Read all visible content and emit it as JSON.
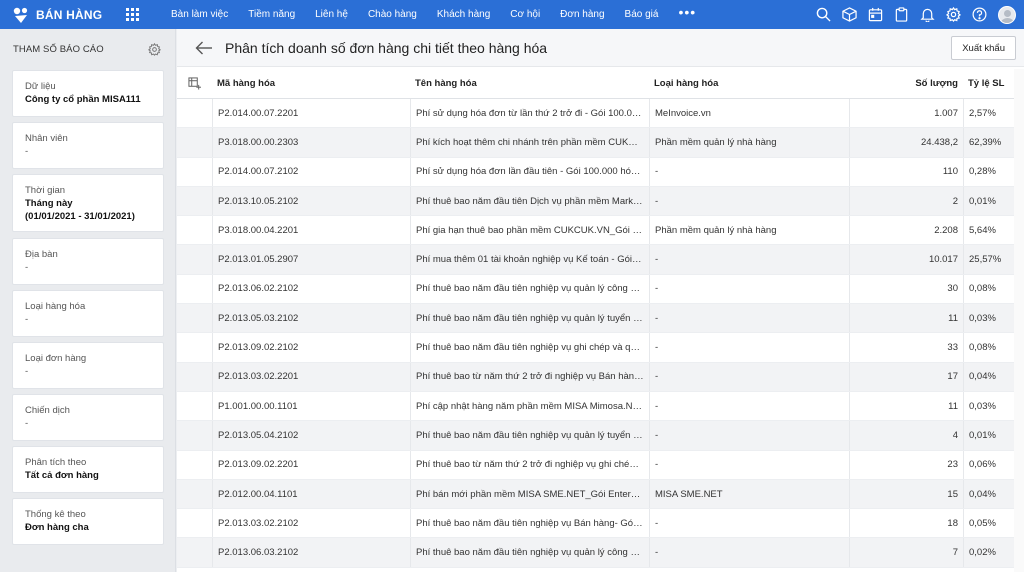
{
  "app": {
    "brand": "BÁN HÀNG",
    "nav": [
      "Bàn làm việc",
      "Tiềm năng",
      "Liên hệ",
      "Chào hàng",
      "Khách hàng",
      "Cơ hội",
      "Đơn hàng",
      "Báo giá"
    ],
    "nav_more": "•••",
    "icons": [
      "search-icon",
      "cube-icon",
      "calendar-icon",
      "clipboard-icon",
      "bell-icon",
      "gear-icon",
      "help-icon",
      "avatar"
    ],
    "accent_color": "#2b6fd6"
  },
  "sidebar": {
    "title": "THAM SỐ BÁO CÁO",
    "params": [
      {
        "label": "Dữ liệu",
        "value": "Công ty cổ phần MISA111",
        "value2": ""
      },
      {
        "label": "Nhân viên",
        "value": "-",
        "value2": ""
      },
      {
        "label": "Thời gian",
        "value": "Tháng này",
        "value2": "(01/01/2021 - 31/01/2021)"
      },
      {
        "label": "Địa bàn",
        "value": "-",
        "value2": ""
      },
      {
        "label": "Loại hàng hóa",
        "value": "-",
        "value2": ""
      },
      {
        "label": "Loại đơn hàng",
        "value": "-",
        "value2": ""
      },
      {
        "label": "Chiến dịch",
        "value": "-",
        "value2": ""
      },
      {
        "label": "Phân tích theo",
        "value": "Tất cả đơn hàng",
        "value2": ""
      },
      {
        "label": "Thống kê theo",
        "value": "Đơn hàng cha",
        "value2": ""
      }
    ]
  },
  "main": {
    "title": "Phân tích doanh số đơn hàng chi tiết theo hàng hóa",
    "export_label": "Xuất khẩu",
    "columns": [
      "Mã hàng hóa",
      "Tên hàng hóa",
      "Loại hàng hóa",
      "Số lượng",
      "Tỷ lệ SL"
    ],
    "rows": [
      {
        "code": "P2.014.00.07.2201",
        "name": "Phí sử dụng hóa đơn từ lần thứ 2 trở đi - Gói 100.000...",
        "type": "MeInvoice.vn",
        "qty": "1.007",
        "ratio": "2,57%"
      },
      {
        "code": "P3.018.00.00.2303",
        "name": "Phí kích hoạt thêm chi nhánh trên phần mềm CUKCU...",
        "type": "Phần mềm quản lý nhà hàng",
        "qty": "24.438,2",
        "ratio": "62,39%"
      },
      {
        "code": "P2.014.00.07.2102",
        "name": "Phí sử dụng hóa đơn lần đầu tiên - Gói 100.000 hóa ...",
        "type": "-",
        "qty": "110",
        "ratio": "0,28%"
      },
      {
        "code": "P2.013.10.05.2102",
        "name": "Phí thuê bao năm đầu tiên Dịch vụ phần mềm Marke...",
        "type": "-",
        "qty": "2",
        "ratio": "0,01%"
      },
      {
        "code": "P3.018.00.04.2201",
        "name": "Phí gia hạn thuê bao phần mềm CUKCUK.VN_Gói Ent...",
        "type": "Phần mềm quản lý nhà hàng",
        "qty": "2.208",
        "ratio": "5,64%"
      },
      {
        "code": "P2.013.01.05.2907",
        "name": "Phí mua thêm 01 tài khoản nghiệp vụ Kế toán - Gói U...",
        "type": "-",
        "qty": "10.017",
        "ratio": "25,57%"
      },
      {
        "code": "P2.013.06.02.2102",
        "name": "Phí thuê bao năm đầu tiên nghiệp vụ quản lý công vi...",
        "type": "-",
        "qty": "30",
        "ratio": "0,08%"
      },
      {
        "code": "P2.013.05.03.2102",
        "name": "Phí thuê bao năm đầu tiên nghiệp vụ quản lý tuyển d...",
        "type": "-",
        "qty": "11",
        "ratio": "0,03%"
      },
      {
        "code": "P2.013.09.02.2102",
        "name": "Phí thuê bao năm đầu tiên nghiệp vụ ghi chép và quả...",
        "type": "-",
        "qty": "33",
        "ratio": "0,08%"
      },
      {
        "code": "P2.013.03.02.2201",
        "name": "Phí thuê bao từ năm thứ 2 trở đi nghiệp vụ Bán hàng ...",
        "type": "-",
        "qty": "17",
        "ratio": "0,04%"
      },
      {
        "code": "P1.001.00.00.1101",
        "name": "Phí cập nhật hàng năm phần mềm MISA Mimosa.NET",
        "type": "-",
        "qty": "11",
        "ratio": "0,03%"
      },
      {
        "code": "P2.013.05.04.2102",
        "name": "Phí thuê bao năm đầu tiên nghiệp vụ quản lý tuyển d...",
        "type": "-",
        "qty": "4",
        "ratio": "0,01%"
      },
      {
        "code": "P2.013.09.02.2201",
        "name": "Phí thuê bao từ năm thứ 2 trở đi nghiệp vụ ghi chép v...",
        "type": "-",
        "qty": "23",
        "ratio": "0,06%"
      },
      {
        "code": "P2.012.00.04.1101",
        "name": "Phí bán mới phần mềm MISA SME.NET_Gói Enterprise",
        "type": "MISA SME.NET",
        "qty": "15",
        "ratio": "0,04%"
      },
      {
        "code": "P2.013.03.02.2102",
        "name": "Phí thuê bao năm đầu tiên nghiệp vụ Bán hàng- Gói ...",
        "type": "-",
        "qty": "18",
        "ratio": "0,05%"
      },
      {
        "code": "P2.013.06.03.2102",
        "name": "Phí thuê bao năm đầu tiên nghiệp vụ quản lý công vi...",
        "type": "-",
        "qty": "7",
        "ratio": "0,02%"
      }
    ]
  }
}
